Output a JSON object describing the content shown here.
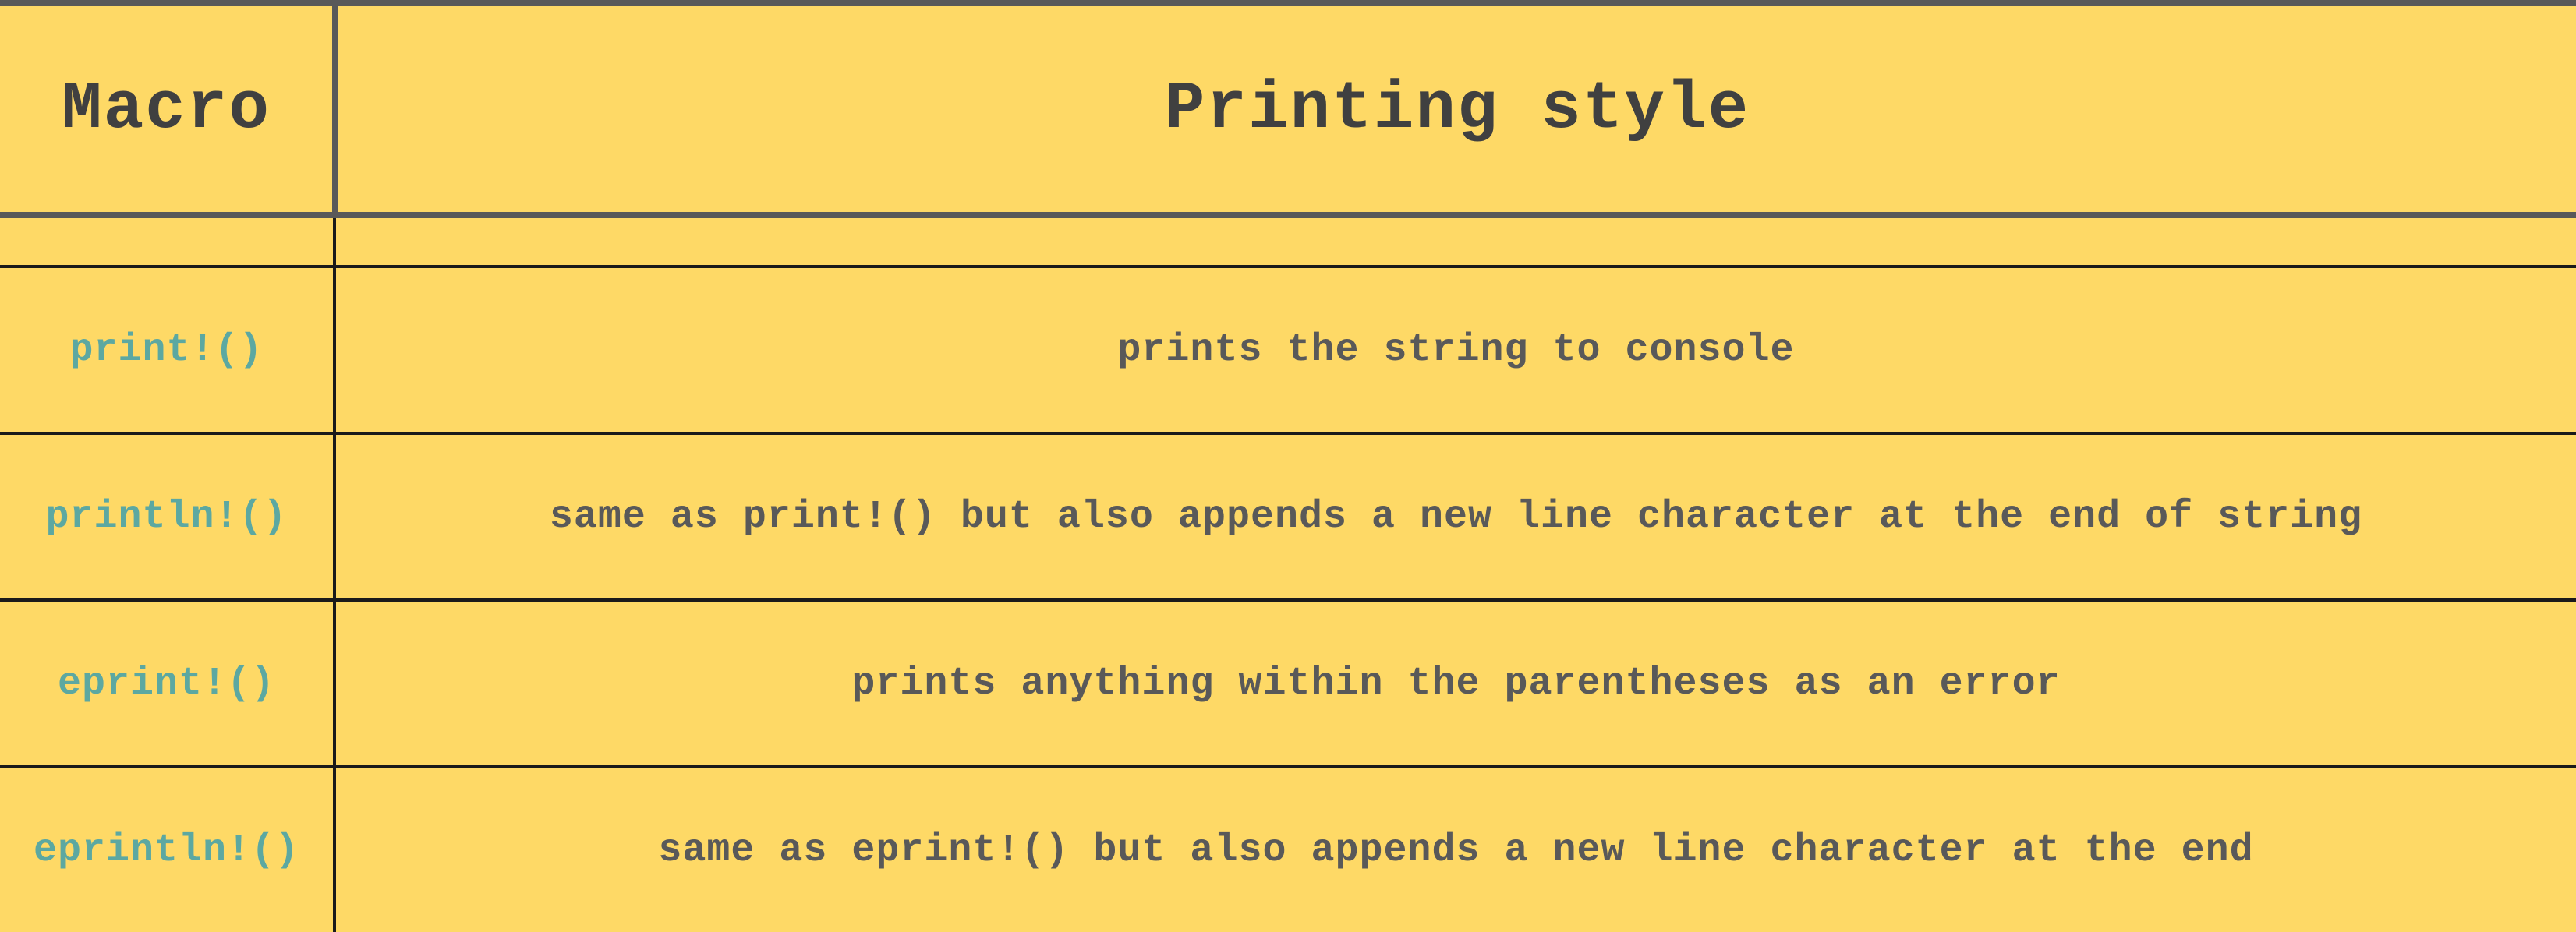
{
  "header": {
    "col_macro": "Macro",
    "col_style": "Printing style"
  },
  "rows": [
    {
      "macro": "print!()",
      "description": "prints the string to console"
    },
    {
      "macro": "println!()",
      "description": "same as print!() but also appends a new line character at the end of string"
    },
    {
      "macro": "eprint!()",
      "description": "prints anything within the parentheses as an error"
    },
    {
      "macro": "eprintln!()",
      "description": "same as eprint!() but also appends a new line character at the end"
    }
  ],
  "colors": {
    "background": "#FED966",
    "header_text": "#404040",
    "macro_text": "#5CA8A1",
    "description_text": "#595959",
    "header_rule": "#595959",
    "body_rule": "#1a1a1a"
  }
}
